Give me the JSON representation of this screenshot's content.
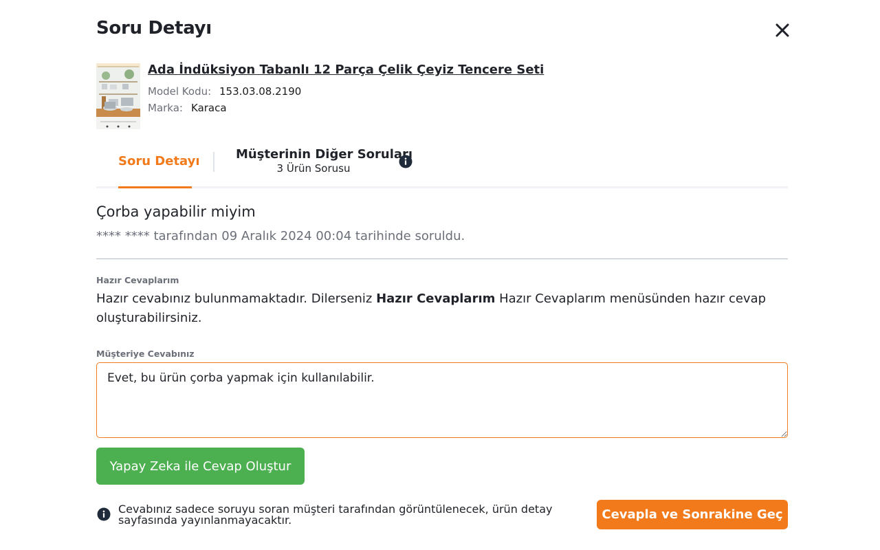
{
  "modal": {
    "title": "Soru Detayı",
    "close_icon": "close-icon"
  },
  "product": {
    "image_icon": "product-thumbnail",
    "name": "Ada İndüksiyon Tabanlı 12 Parça Çelik Çeyiz Tencere Seti",
    "model_label": "Model Kodu:",
    "model_value": "153.03.08.2190",
    "brand_label": "Marka:",
    "brand_value": "Karaca"
  },
  "tabs": {
    "active_label": "Soru Detayı",
    "other_label": "Müşterinin Diğer Soruları",
    "other_sub": "3 Ürün Sorusu",
    "info_icon": "info-icon"
  },
  "question": {
    "text": "Çorba yapabilir miyim",
    "asked_by": "**** **** tarafından 09 Aralık 2024 00:04 tarihinde soruldu."
  },
  "ready_answers": {
    "label": "Hazır Cevaplarım",
    "text_before": "Hazır cevabınız bulunmamaktadır. Dilerseniz ",
    "text_bold": "Hazır Cevaplarım",
    "text_after": " Hazır Cevaplarım menüsünden hazır cevap oluşturabilirsiniz."
  },
  "answer": {
    "label": "Müşteriye Cevabınız",
    "value": "Evet, bu ürün çorba yapmak için kullanılabilir."
  },
  "actions": {
    "ai_button": "Yapay Zeka ile Cevap Oluştur",
    "submit_button": "Cevapla ve Sonrakine Geç"
  },
  "note": {
    "icon": "info-icon",
    "text": "Cevabınız sadece soruyu soran müşteri tarafından görüntülenecek, ürün detay sayfasında yayınlanmayacaktır."
  },
  "colors": {
    "accent": "#f27a1a",
    "green": "#4caf50",
    "text": "#1f2228",
    "muted": "#6b6f78"
  }
}
